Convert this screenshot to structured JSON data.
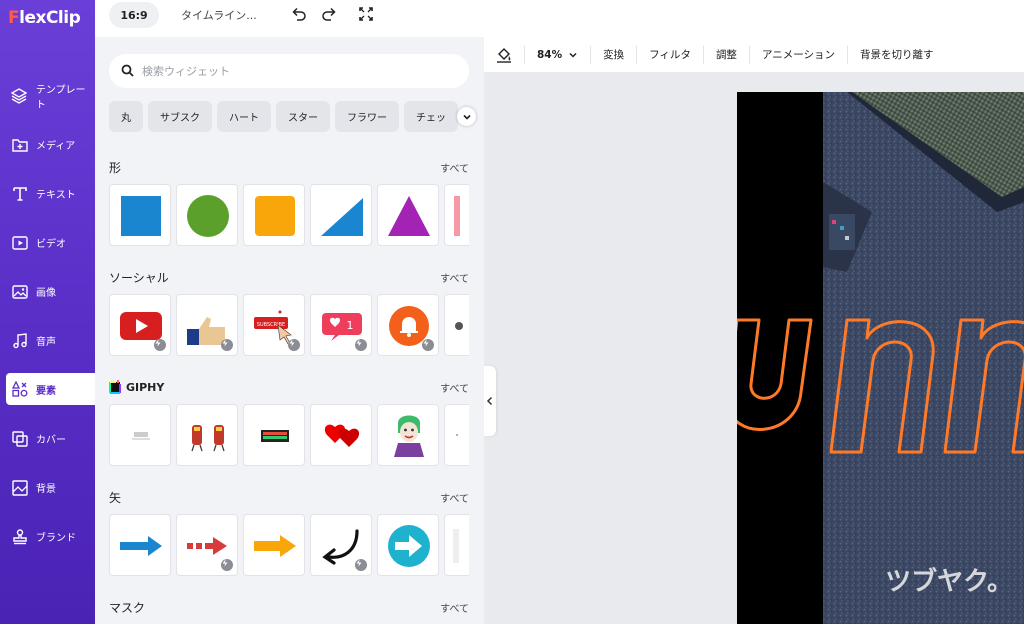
{
  "app": {
    "logo_f": "F",
    "logo_rest": "lexClip"
  },
  "sidebar": {
    "items": [
      {
        "label": "テンプレート",
        "icon": "layers-icon"
      },
      {
        "label": "メディア",
        "icon": "media-folder-icon"
      },
      {
        "label": "テキスト",
        "icon": "text-icon"
      },
      {
        "label": "ビデオ",
        "icon": "video-icon"
      },
      {
        "label": "画像",
        "icon": "image-icon"
      },
      {
        "label": "音声",
        "icon": "music-icon"
      },
      {
        "label": "要素",
        "icon": "elements-icon",
        "active": true
      },
      {
        "label": "カバー",
        "icon": "cover-icon"
      },
      {
        "label": "背景",
        "icon": "background-icon"
      },
      {
        "label": "ブランド",
        "icon": "brand-stamp-icon"
      }
    ]
  },
  "topbar": {
    "ratio": "16:9",
    "timeline": "タイムライン..."
  },
  "search": {
    "placeholder": "検索ウィジェット"
  },
  "chips": [
    "丸",
    "サブスク",
    "ハート",
    "スター",
    "フラワー",
    "チェッ"
  ],
  "sections": [
    {
      "id": "shapes",
      "title": "形",
      "all": "すべて"
    },
    {
      "id": "social",
      "title": "ソーシャル",
      "all": "すべて"
    },
    {
      "id": "giphy",
      "title": "GIPHY",
      "all": "すべて"
    },
    {
      "id": "arrows",
      "title": "矢",
      "all": "すべて"
    },
    {
      "id": "mask",
      "title": "マスク",
      "all": "すべて"
    }
  ],
  "toolbar": {
    "zoom": "84%",
    "items": [
      "変換",
      "フィルタ",
      "調整",
      "アニメーション",
      "背景を切り離す"
    ]
  },
  "colors": {
    "accent": "#5a2fc8",
    "shape_blue": "#1a86d0",
    "shape_green": "#5aa02a",
    "shape_orange": "#f8a60a",
    "shape_purple": "#a323b5",
    "outline_text": "#ff7a28"
  },
  "canvas": {
    "text": "un",
    "watermark": "ツブヤク。"
  }
}
